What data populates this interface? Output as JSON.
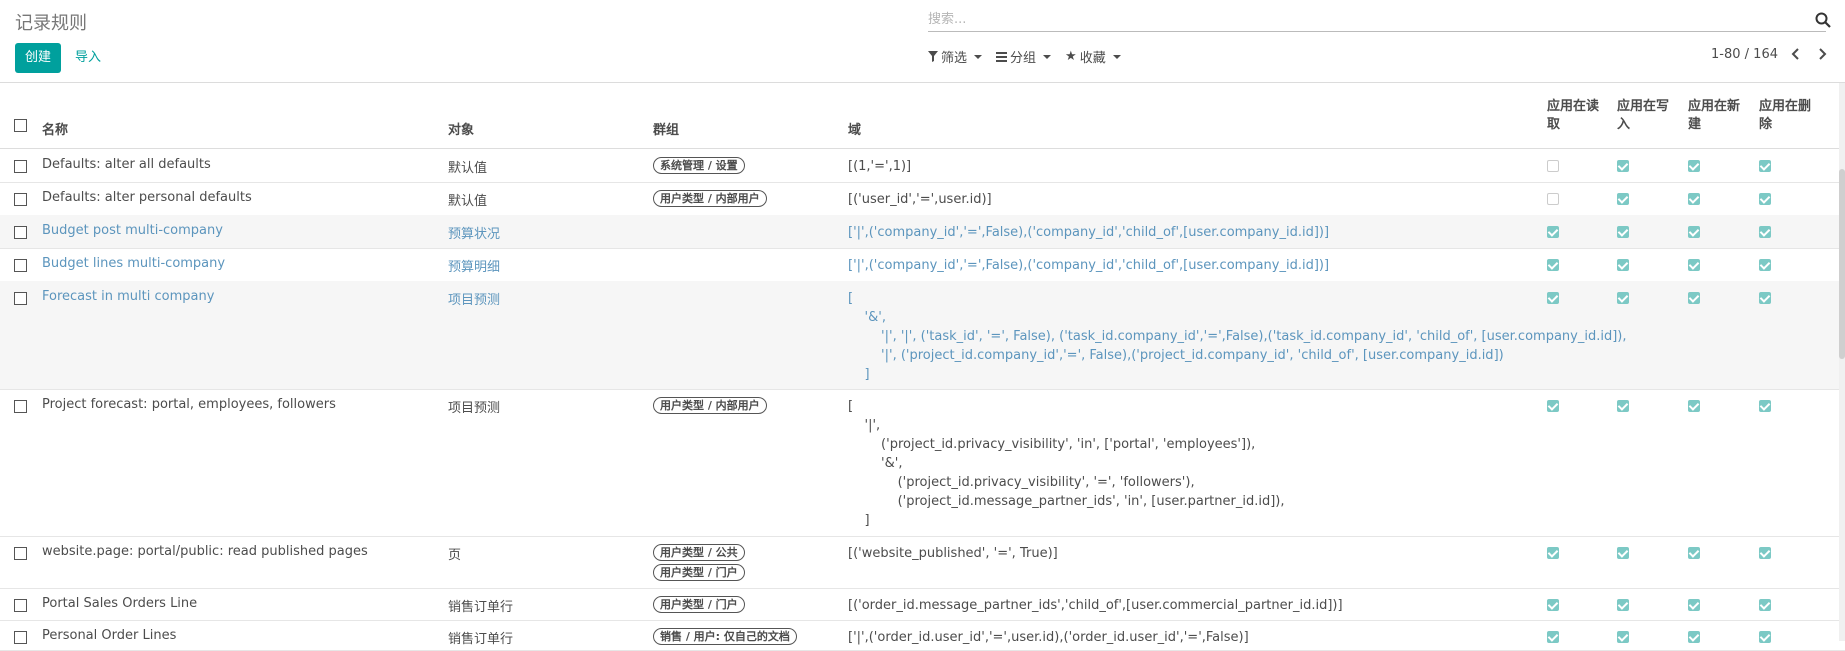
{
  "header": {
    "title": "记录规则",
    "create_label": "创建",
    "import_label": "导入"
  },
  "search": {
    "placeholder": "搜索..."
  },
  "options": {
    "filters": "筛选",
    "group_by": "分组",
    "favorites": "收藏"
  },
  "pager": {
    "value": "1-80 / 164"
  },
  "columns": {
    "name": "名称",
    "model": "对象",
    "groups": "群组",
    "domain": "域",
    "read": "应用在读取",
    "write": "应用在写入",
    "create": "应用在新建",
    "unlink": "应用在删除"
  },
  "rows": [
    {
      "name": "Defaults: alter all defaults",
      "model": "默认值",
      "groups": [
        "系统管理 / 设置"
      ],
      "domain": [
        "[(1,'=',1)]"
      ],
      "perm_read": false,
      "perm_write": true,
      "perm_create": true,
      "perm_unlink": true
    },
    {
      "name": "Defaults: alter personal defaults",
      "model": "默认值",
      "groups": [
        "用户类型 / 内部用户"
      ],
      "domain": [
        "[('user_id','=',user.id)]"
      ],
      "perm_read": false,
      "perm_write": true,
      "perm_create": true,
      "perm_unlink": true
    },
    {
      "name": "Budget post multi-company",
      "model": "预算状况",
      "groups": [],
      "domain": [
        "['|',('company_id','=',False),('company_id','child_of',[user.company_id.id])]"
      ],
      "perm_read": true,
      "perm_write": true,
      "perm_create": true,
      "perm_unlink": true
    },
    {
      "name": "Budget lines multi-company",
      "model": "预算明细",
      "groups": [],
      "domain": [
        "['|',('company_id','=',False),('company_id','child_of',[user.company_id.id])]"
      ],
      "perm_read": true,
      "perm_write": true,
      "perm_create": true,
      "perm_unlink": true
    },
    {
      "name": "Forecast in multi company",
      "model": "项目预测",
      "groups": [],
      "domain": [
        "[",
        "    '&',",
        "        '|', '|', ('task_id', '=', False), ('task_id.company_id','=',False),('task_id.company_id', 'child_of', [user.company_id.id]),",
        "        '|', ('project_id.company_id','=', False),('project_id.company_id', 'child_of', [user.company_id.id])",
        "    ]"
      ],
      "perm_read": true,
      "perm_write": true,
      "perm_create": true,
      "perm_unlink": true
    },
    {
      "name": "Project forecast: portal, employees, followers",
      "model": "项目预测",
      "groups": [
        "用户类型 / 内部用户"
      ],
      "domain": [
        "[",
        "    '|',",
        "        ('project_id.privacy_visibility', 'in', ['portal', 'employees']),",
        "        '&',",
        "            ('project_id.privacy_visibility', '=', 'followers'),",
        "            ('project_id.message_partner_ids', 'in', [user.partner_id.id]),",
        "    ]"
      ],
      "perm_read": true,
      "perm_write": true,
      "perm_create": true,
      "perm_unlink": true
    },
    {
      "name": "website.page: portal/public: read published pages",
      "model": "页",
      "groups": [
        "用户类型 / 公共",
        "用户类型 / 门户"
      ],
      "domain": [
        "[('website_published', '=', True)]"
      ],
      "perm_read": true,
      "perm_write": true,
      "perm_create": true,
      "perm_unlink": true
    },
    {
      "name": "Portal Sales Orders Line",
      "model": "销售订单行",
      "groups": [
        "用户类型 / 门户"
      ],
      "domain": [
        "[('order_id.message_partner_ids','child_of',[user.commercial_partner_id.id])]"
      ],
      "perm_read": true,
      "perm_write": true,
      "perm_create": true,
      "perm_unlink": true
    },
    {
      "name": "Personal Order Lines",
      "model": "销售订单行",
      "groups": [
        "销售 / 用户: 仅自己的文档"
      ],
      "domain": [
        "['|',('order_id.user_id','=',user.id),('order_id.user_id','=',False)]"
      ],
      "perm_read": true,
      "perm_write": true,
      "perm_create": true,
      "perm_unlink": true
    }
  ],
  "row_styles": [
    "plain",
    "plain",
    "alt",
    "plain",
    "alt",
    "plain",
    "plain",
    "plain",
    "plain"
  ],
  "row_links": [
    false,
    false,
    true,
    true,
    true,
    false,
    false,
    false,
    false
  ]
}
